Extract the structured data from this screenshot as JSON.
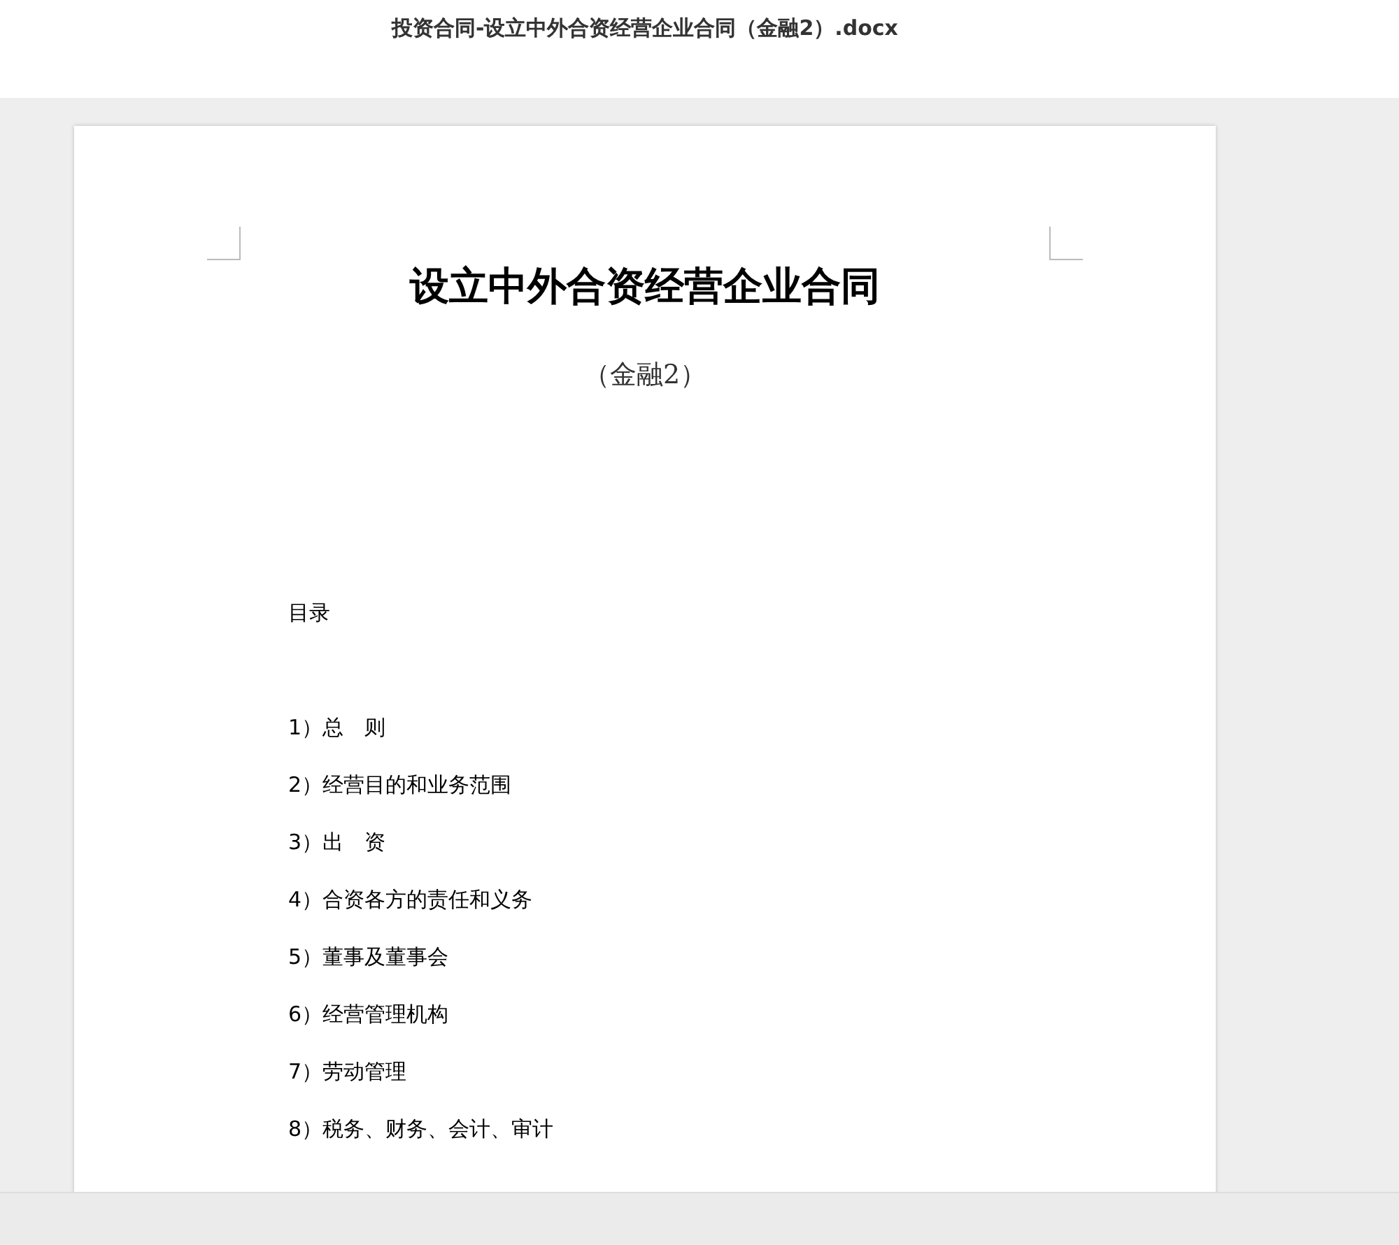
{
  "window": {
    "title": "投资合同-设立中外合资经营企业合同（金融2）.docx"
  },
  "document": {
    "title": "设立中外合资经营企业合同",
    "subtitle": "（金融2）",
    "toc_heading": "目录",
    "toc_items": [
      "1）总　则",
      "2）经营目的和业务范围",
      "3）出　资",
      "4）合资各方的责任和义务",
      "5）董事及董事会",
      "6）经营管理机构",
      "7）劳动管理",
      "8）税务、财务、会计、审计"
    ]
  }
}
